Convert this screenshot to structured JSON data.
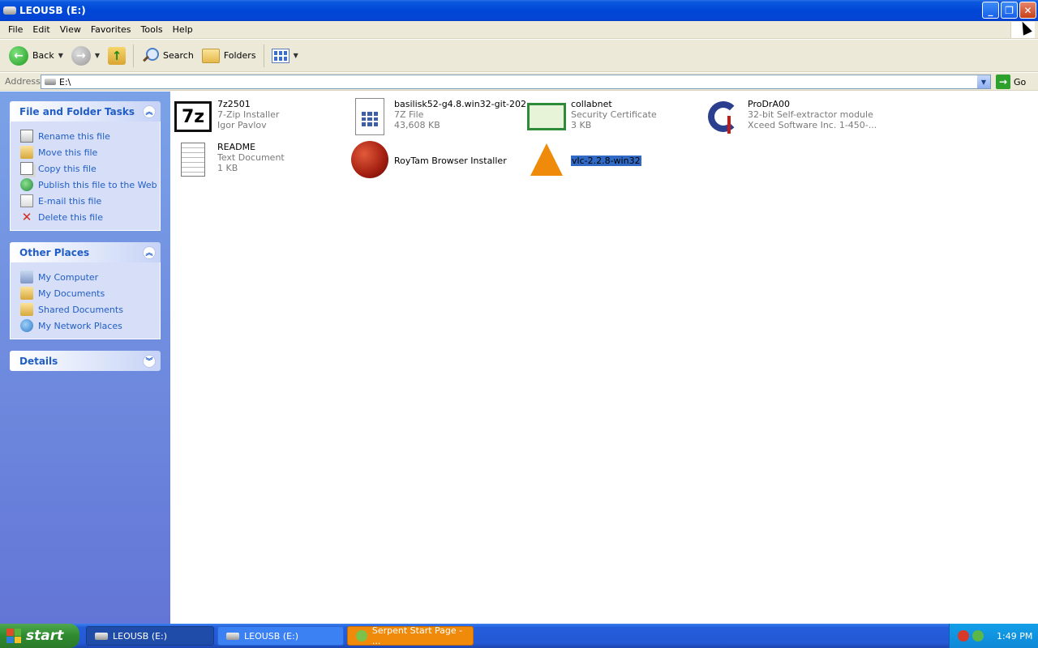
{
  "window": {
    "title": "LEOUSB (E:)",
    "minimize": "_",
    "restore": "❐",
    "close": "✕"
  },
  "menu": [
    "File",
    "Edit",
    "View",
    "Favorites",
    "Tools",
    "Help"
  ],
  "toolbar": {
    "back": "Back",
    "search": "Search",
    "folders": "Folders"
  },
  "address": {
    "label": "Address",
    "value": "E:\\",
    "go": "Go"
  },
  "tasks_panel": {
    "title": "File and Folder Tasks",
    "items": [
      "Rename this file",
      "Move this file",
      "Copy this file",
      "Publish this file to the Web",
      "E-mail this file",
      "Delete this file"
    ]
  },
  "places_panel": {
    "title": "Other Places",
    "items": [
      "My Computer",
      "My Documents",
      "Shared Documents",
      "My Network Places"
    ]
  },
  "details_panel": {
    "title": "Details"
  },
  "files": [
    {
      "name": "7z2501",
      "line2": "7-Zip Installer",
      "line3": "Igor Pavlov",
      "icon": "7zip-icon"
    },
    {
      "name": "basilisk52-g4.8.win32-git-202...",
      "line2": "7Z File",
      "line3": "43,608 KB",
      "icon": "archive-icon"
    },
    {
      "name": "collabnet",
      "line2": "Security Certificate",
      "line3": "3 KB",
      "icon": "certificate-icon"
    },
    {
      "name": "ProDrA00",
      "line2": "32-bit Self-extractor module",
      "line3": "Xceed Software Inc.    1-450-...",
      "icon": "installer-icon"
    },
    {
      "name": "README",
      "line2": "Text Document",
      "line3": "1 KB",
      "icon": "notepad-icon"
    },
    {
      "name": "RoyTam Browser Installer",
      "line2": "",
      "line3": "",
      "icon": "browser-installer-icon"
    },
    {
      "name": "vlc-2.2.8-win32",
      "line2": "",
      "line3": "",
      "icon": "vlc-icon"
    }
  ],
  "taskbar": {
    "start": "start",
    "buttons": [
      "LEOUSB (E:)",
      "LEOUSB (E:)",
      "Serpent Start Page - ..."
    ],
    "clock": "1:49 PM"
  }
}
